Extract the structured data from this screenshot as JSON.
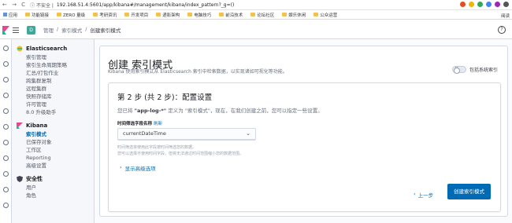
{
  "browser": {
    "nav": "← → C",
    "secure": "ⓘ 不安全 |",
    "url": "192.168.51.4:5601/app/kibana#/management/kibana/index_pattern?_g=()",
    "bookmarks": [
      "应用",
      "功能链接",
      "ZERO 量级",
      "考研资讯",
      "开发项目",
      "递影架构",
      "电脑技巧",
      "前沿技术",
      "论坛社区",
      "娱乐休闲",
      "公众运营"
    ],
    "bookmarks_right": "阅读"
  },
  "header": {
    "space": "D",
    "breadcrumbs": [
      "管理",
      "/",
      "索引模式",
      "/"
    ],
    "current": "创建索引模式",
    "help_icon": "?"
  },
  "sidenav": {
    "elasticsearch": {
      "title": "Elasticsearch",
      "items": [
        "索引管理",
        "索引生命周期策略",
        "汇总/打包作业",
        "跨集群复制",
        "远程集群",
        "快照存储库",
        "许可管理",
        "8.0 升级助手"
      ]
    },
    "kibana": {
      "title": "Kibana",
      "items": [
        "索引模式",
        "已保存对象",
        "工作区",
        "Reporting",
        "高级设置"
      ]
    },
    "security": {
      "title": "安全性",
      "items": [
        "用户",
        "角色"
      ]
    }
  },
  "main": {
    "title": "创建 索引模式",
    "description": "Kibana 使用索引模式从 Elasticsearch 索引中检索数据，以实现诸如可视化等功能。",
    "toggle_label": "包括系统索引",
    "step_title": "第 2 步 (共 2 步)：配置设置",
    "hint_prefix": "您已将",
    "hint_pattern": "\"app-log-*\"",
    "hint_suffix": "定义为 \"索引模式\"，现在，在我们创建之前，您可以指定一些设置。",
    "field_label": "时间筛选字段名称",
    "field_refresh": "刷新",
    "select_value": "currentDateTime",
    "help_line1": "时间筛选将使用此字段按时间筛选您的数据。",
    "help_line2": "您可以选择不使用时间字段，但将无法通过时间范围缩小您的数据范围。",
    "advanced": "显示高级选项",
    "back_button": "上一步",
    "create_button": "创建索引模式"
  },
  "colors": {
    "primary": "#006bb4",
    "space_badge": "#3fa69a"
  }
}
